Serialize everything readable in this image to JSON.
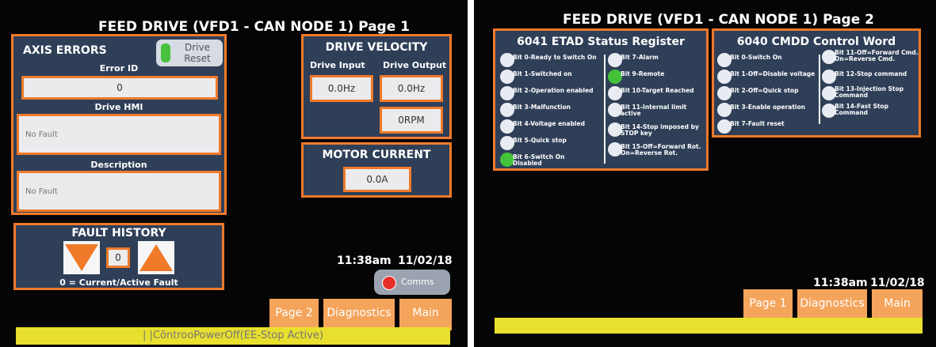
{
  "page1": {
    "title": "FEED DRIVE (VFD1 - CAN NODE 1) Page 1",
    "axis_errors": {
      "heading": "AXIS ERRORS",
      "drive_reset_label": "Drive Reset",
      "error_id_label": "Error ID",
      "error_id_value": "0",
      "drive_hmi_label": "Drive HMI",
      "drive_hmi_value": "No Fault",
      "description_label": "Description",
      "description_value": "No Fault"
    },
    "drive_velocity": {
      "heading": "DRIVE VELOCITY",
      "input_label": "Drive Input",
      "output_label": "Drive Output",
      "input_value": "0.0Hz",
      "output_value": "0.0Hz",
      "rpm_value": "0RPM"
    },
    "motor_current": {
      "heading": "MOTOR CURRENT",
      "value": "0.0A"
    },
    "fault_history": {
      "heading": "FAULT HISTORY",
      "index_value": "0",
      "note": "0 = Current/Active Fault"
    },
    "time": "11:38am",
    "date": "11/02/18",
    "comms_label": "Comms",
    "nav": {
      "page": "Page 2",
      "diagnostics": "Diagnostics",
      "main": "Main"
    },
    "status_bar": "| |CōntrooPowerOff(EE-Stop Active)"
  },
  "page2": {
    "title": "FEED DRIVE (VFD1 - CAN NODE 1) Page 2",
    "status_register": {
      "heading": "6041 ETAD Status Register",
      "col1": [
        {
          "label": "Bit 0-Ready to Switch On",
          "on": false
        },
        {
          "label": "Bit 1-Switched on",
          "on": false
        },
        {
          "label": "Bit 2-Operation enabled",
          "on": false
        },
        {
          "label": "Bit 3-Malfunction",
          "on": false
        },
        {
          "label": "Bit 4-Voltage enabled",
          "on": false
        },
        {
          "label": "Bit 5-Quick stop",
          "on": false
        },
        {
          "label": "Bit 6-Switch On\nDisabled",
          "on": true
        }
      ],
      "col2": [
        {
          "label": "Bit 7-Alarm",
          "on": false
        },
        {
          "label": "Bit 9-Remote",
          "on": true
        },
        {
          "label": "Bit 10-Target Reached",
          "on": false
        },
        {
          "label": "Bit 11-Internal limit\nactive",
          "on": false
        },
        {
          "label": "Bit 14-Stop imposed by\nSTOP key",
          "on": false
        },
        {
          "label": "Bit 15-Off=Forward Rot.\nOn=Reverse Rot.",
          "on": false
        }
      ]
    },
    "control_word": {
      "heading": "6040 CMDD Control Word",
      "col1": [
        {
          "label": "Bit 0-Switch On"
        },
        {
          "label": "Bit 1-Off=Disable voltage"
        },
        {
          "label": "Bit 2-Off=Quick stop"
        },
        {
          "label": "Bit 3-Enable operation"
        },
        {
          "label": "Bit 7-Fault reset"
        }
      ],
      "col2": [
        {
          "label": "Bit 11-Off=Forward Cmd.\nOn=Reverse Cmd."
        },
        {
          "label": "Bit 12-Stop command"
        },
        {
          "label": "Bit 13-Injection Stop\nCommand"
        },
        {
          "label": "Bit 14-Fast Stop\nCommand"
        }
      ]
    },
    "time": "11:38am",
    "date": "11/02/18",
    "nav": {
      "page": "Page 1",
      "diagnostics": "Diagnostics",
      "main": "Main"
    }
  },
  "colors": {
    "accent_orange": "#f07a2a",
    "panel_blue": "#2f3f58",
    "led_on": "#44c23a",
    "status_yellow": "#e8df2e"
  }
}
